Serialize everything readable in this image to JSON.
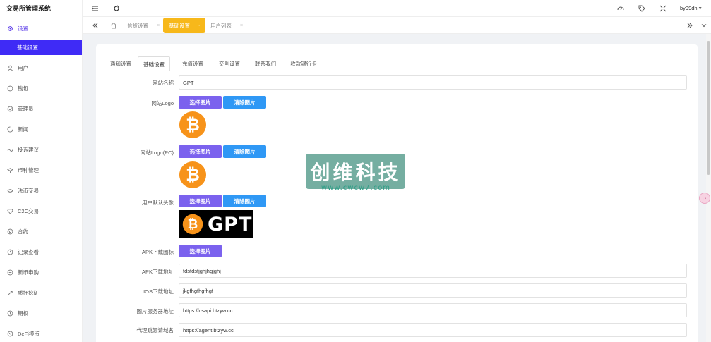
{
  "app": {
    "title": "交易所管理系统"
  },
  "sidebar": {
    "items": [
      {
        "label": "设置",
        "icon": "gear-icon",
        "state": "active-parent"
      },
      {
        "label": "基础设置",
        "icon": "",
        "state": "active-child"
      },
      {
        "label": "用户",
        "icon": "user-icon"
      },
      {
        "label": "钱包",
        "icon": "wallet-icon"
      },
      {
        "label": "管理员",
        "icon": "admin-icon"
      },
      {
        "label": "新闻",
        "icon": "news-icon"
      },
      {
        "label": "投诉建议",
        "icon": "feedback-icon"
      },
      {
        "label": "币种管理",
        "icon": "coin-icon"
      },
      {
        "label": "法币交易",
        "icon": "fiat-icon"
      },
      {
        "label": "C2C交易",
        "icon": "c2c-icon"
      },
      {
        "label": "合约",
        "icon": "contract-icon"
      },
      {
        "label": "记录查看",
        "icon": "record-icon"
      },
      {
        "label": "新币申购",
        "icon": "subscribe-icon"
      },
      {
        "label": "质押挖矿",
        "icon": "mining-icon"
      },
      {
        "label": "期权",
        "icon": "option-icon"
      },
      {
        "label": "DeFi模币",
        "icon": "defi-icon"
      }
    ]
  },
  "header": {
    "user": "by99dh",
    "icons": [
      "menu-fold-icon",
      "refresh-icon",
      "theme-icon",
      "tag-icon",
      "fullscreen-icon"
    ]
  },
  "tabs": [
    {
      "label": "信贷设置",
      "active": false
    },
    {
      "label": "基础设置",
      "active": true
    },
    {
      "label": "用户列表",
      "active": false
    }
  ],
  "inner_tabs": [
    "通知设置",
    "基础设置",
    "充值设置",
    "交割设置",
    "联系我们",
    "收款银行卡"
  ],
  "form": {
    "site_name_label": "网站名称",
    "site_name_value": "GPT",
    "logo_label": "网站Logo",
    "logo_pc_label": "网站Logo(PC)",
    "avatar_label": "用户默认头像",
    "apk_icon_label": "APK下载图标",
    "apk_url_label": "APK下载地址",
    "apk_url_value": "fdsfdsfjghjhgjghj",
    "ios_url_label": "IOS下载地址",
    "ios_url_value": "jkgfhgfhgfhgf",
    "image_server_label": "图片服务器地址",
    "image_server_value": "https://csapi.btzyw.cc",
    "agent_domain_label": "代理跳源请域名",
    "agent_domain_value": "https://agent.btzyw.cc",
    "choose_image": "选择图片",
    "clear_image": "清除图片",
    "banner_text": "GPT"
  },
  "watermark": {
    "title": "创维科技",
    "url": "www.cwcw7.com"
  },
  "colors": {
    "accent": "#3f2bf6",
    "tab_active": "#f7b81a",
    "btn_purple": "#7b62ee",
    "btn_blue": "#2f98f5",
    "bitcoin": "#f7931a"
  }
}
